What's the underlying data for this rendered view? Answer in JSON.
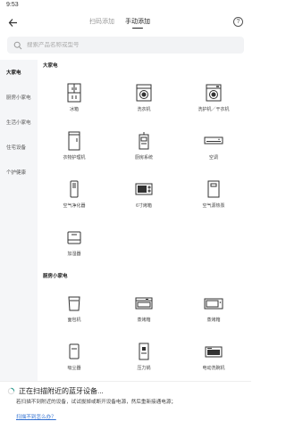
{
  "status": {
    "time": "9:53"
  },
  "header": {
    "tabs": [
      {
        "label": "扫码添加",
        "active": false
      },
      {
        "label": "手动添加",
        "active": true
      }
    ],
    "help_label": "?"
  },
  "search": {
    "placeholder": "搜索产品名称或型号"
  },
  "sidebar": {
    "items": [
      {
        "label": "大家电",
        "active": true
      },
      {
        "label": "厨房小家电",
        "active": false
      },
      {
        "label": "生活小家电",
        "active": false
      },
      {
        "label": "住宅设备",
        "active": false
      },
      {
        "label": "个护健康",
        "active": false
      }
    ]
  },
  "sections": [
    {
      "title": "大家电",
      "items": [
        {
          "label": "冰箱",
          "icon": "fridge-icon"
        },
        {
          "label": "洗衣机",
          "icon": "washer-icon"
        },
        {
          "label": "洗护机／干衣机",
          "icon": "dryer-icon"
        },
        {
          "label": "衣物护理机",
          "icon": "clothes-care-icon"
        },
        {
          "label": "厨房系统",
          "icon": "kitchen-system-icon"
        },
        {
          "label": "空调",
          "icon": "ac-icon"
        },
        {
          "label": "空气净化器",
          "icon": "air-purifier-icon"
        },
        {
          "label": "6寸烤箱",
          "icon": "oven-icon"
        },
        {
          "label": "空气源热泵",
          "icon": "heat-pump-icon"
        },
        {
          "label": "加湿器",
          "icon": "humidifier-icon"
        }
      ]
    },
    {
      "title": "厨房小家电",
      "items": [
        {
          "label": "面包机",
          "icon": "bread-maker-icon"
        },
        {
          "label": "蒸烤箱",
          "icon": "steam-oven-icon"
        },
        {
          "label": "蒸烤箱",
          "icon": "steam-oven-2-icon"
        },
        {
          "label": "吸尘器",
          "icon": "vacuum-icon"
        },
        {
          "label": "压力锅",
          "icon": "pressure-cooker-icon"
        },
        {
          "label": "电动洗碗机",
          "icon": "dishwasher-icon"
        }
      ]
    }
  ],
  "toast": {
    "title": "正在扫描附近的蓝牙设备...",
    "text": "若扫描不到附近的设备，试试拔掉或断开设备电源，然后重新接通电源；",
    "link": "扫描不到怎么办？"
  }
}
